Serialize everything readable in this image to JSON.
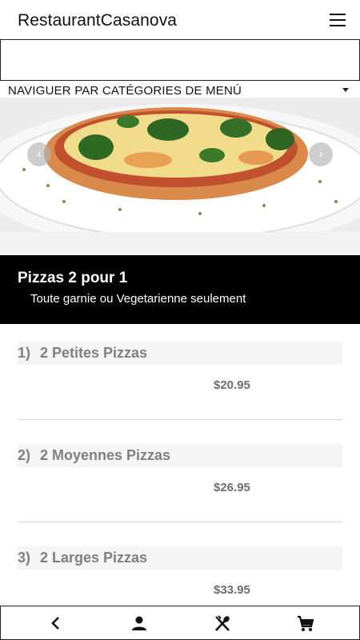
{
  "app": {
    "title": "RestaurantCasanova"
  },
  "header": {
    "menu_icon": "hamburger-menu-icon"
  },
  "search": {
    "value": ""
  },
  "category_select": {
    "label": "NAVIGUER PAR CATÉGORIES DE MENÚ"
  },
  "carousel": {
    "prev_label": "‹",
    "next_label": "›"
  },
  "banner": {
    "title": "Pizzas 2 pour 1",
    "subtitle": "Toute garnie ou Vegetarienne seulement"
  },
  "menu_items": [
    {
      "number": "1)",
      "name": "2 Petites Pizzas",
      "price": "$20.95"
    },
    {
      "number": "2)",
      "name": "2 Moyennes Pizzas",
      "price": "$26.95"
    },
    {
      "number": "3)",
      "name": "2 Larges Pizzas",
      "price": "$33.95"
    }
  ],
  "bottom_nav": {
    "items": [
      "back-icon",
      "user-icon",
      "utensils-icon",
      "cart-icon"
    ]
  },
  "colors": {
    "banner_bg": "#000000",
    "item_name": "#808080",
    "price": "#6e6e6e"
  }
}
